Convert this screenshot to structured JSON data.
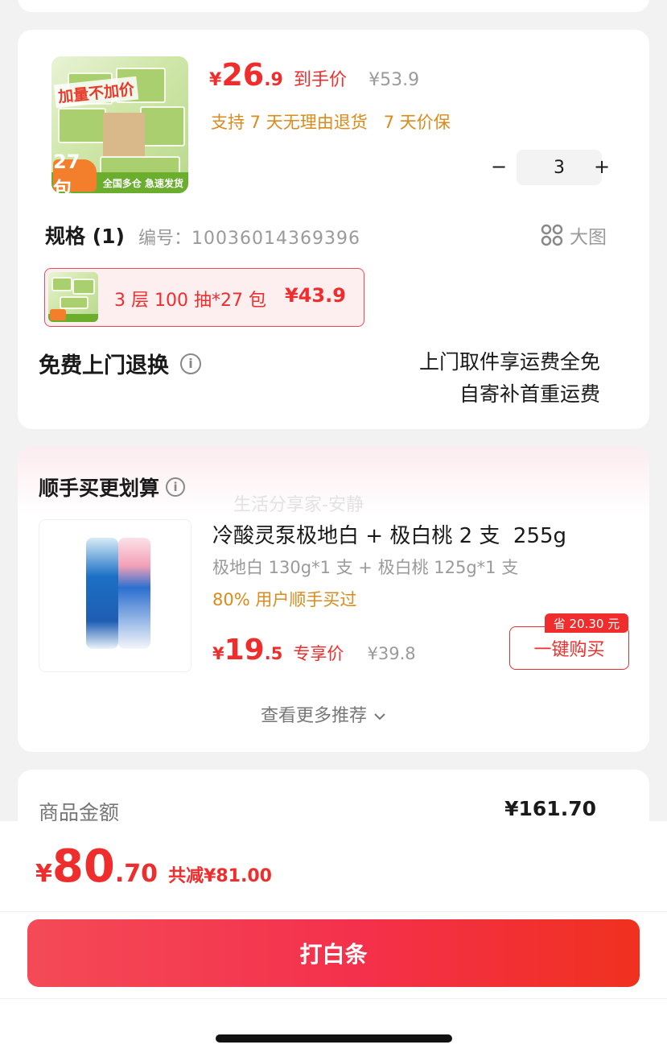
{
  "product": {
    "price_symbol": "¥",
    "price_main": "26",
    "price_decimal": ".9",
    "price_label": "到手价",
    "original_price": "¥53.9",
    "services": "支持 7 天无理由退货   7 天价保",
    "quantity": "3",
    "qty_minus": "−",
    "qty_plus": "+",
    "thumb_slogan": "加量不加价",
    "thumb_count": "27包",
    "thumb_banner": "全国多仓 急速发货"
  },
  "spec": {
    "title": "规格 (1)",
    "sku_label": "编号：",
    "sku_value": "10036014369396",
    "large_image_label": "大图",
    "option_text": "3 层 100 抽*27 包",
    "option_price": "¥43.9"
  },
  "return_service": {
    "title": "免费上门退换",
    "line1": "上门取件享运费全免",
    "line2": "自寄补首重运费"
  },
  "recommend": {
    "title": "顺手买更划算",
    "watermark": "生活分享家-安静",
    "item_title": "冷酸灵泵极地白 + 极白桃 2 支  255g",
    "item_desc": "极地白 130g*1 支 + 极白桃 125g*1 支",
    "item_stat": "80% 用户顺手买过",
    "price_symbol": "¥",
    "price_main": "19",
    "price_decimal": ".5",
    "price_label": "专享价",
    "original_price": "¥39.8",
    "save_badge": "省 20.30 元",
    "buy_button": "一键购买",
    "more_link": "查看更多推荐"
  },
  "summary": {
    "goods_amount_label": "商品金额",
    "goods_amount_value": "¥161.70"
  },
  "checkout": {
    "total_symbol": "¥",
    "total_main": "80",
    "total_decimal": ".70",
    "discount_text": "共减¥81.00",
    "pay_button": "打白条"
  }
}
